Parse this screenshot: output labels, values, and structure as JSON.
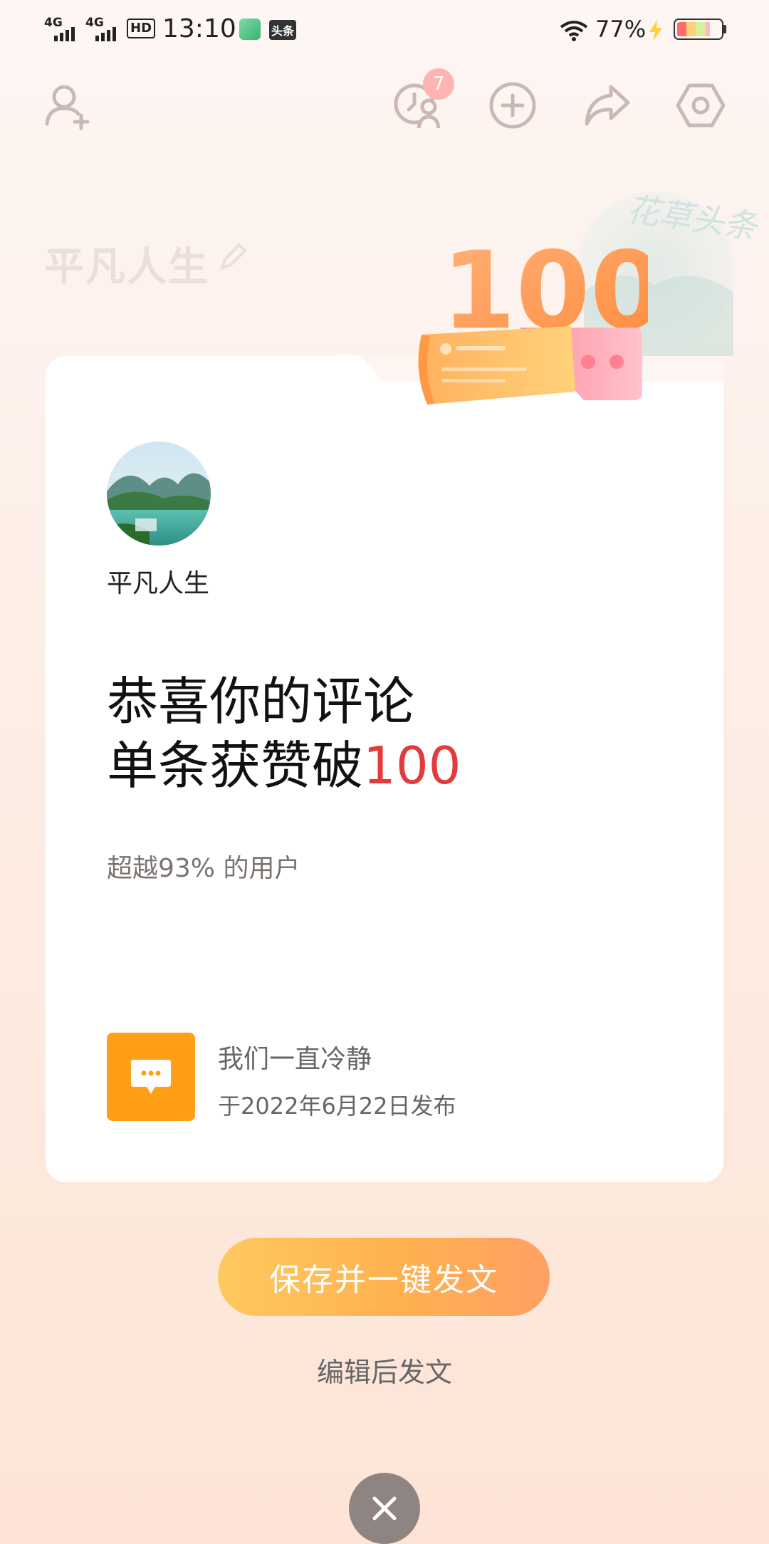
{
  "status_bar": {
    "time": "13:10",
    "net1": "4G",
    "net2": "4G",
    "hd": "HD",
    "app_badge": "头条",
    "battery_percent": "77%",
    "battery_level": 0.77
  },
  "header": {
    "notification_count": "7",
    "faded_username": "平凡人生"
  },
  "trophy": {
    "number": "100"
  },
  "watermark_text": "花草头条",
  "card": {
    "username": "平凡人生",
    "headline_line1": "恭喜你的评论",
    "headline_line2_prefix": "单条获赞破",
    "headline_line2_highlight": "100",
    "subline": "超越93% 的用户",
    "post": {
      "title": "我们一直冷静",
      "date": "于2022年6月22日发布"
    }
  },
  "actions": {
    "primary_label": "保存并一键发文",
    "secondary_label": "编辑后发文"
  },
  "colors": {
    "accent_red": "#e33b3b",
    "button_orange": "#ffb14f",
    "thumb_orange": "#ff9e17"
  }
}
